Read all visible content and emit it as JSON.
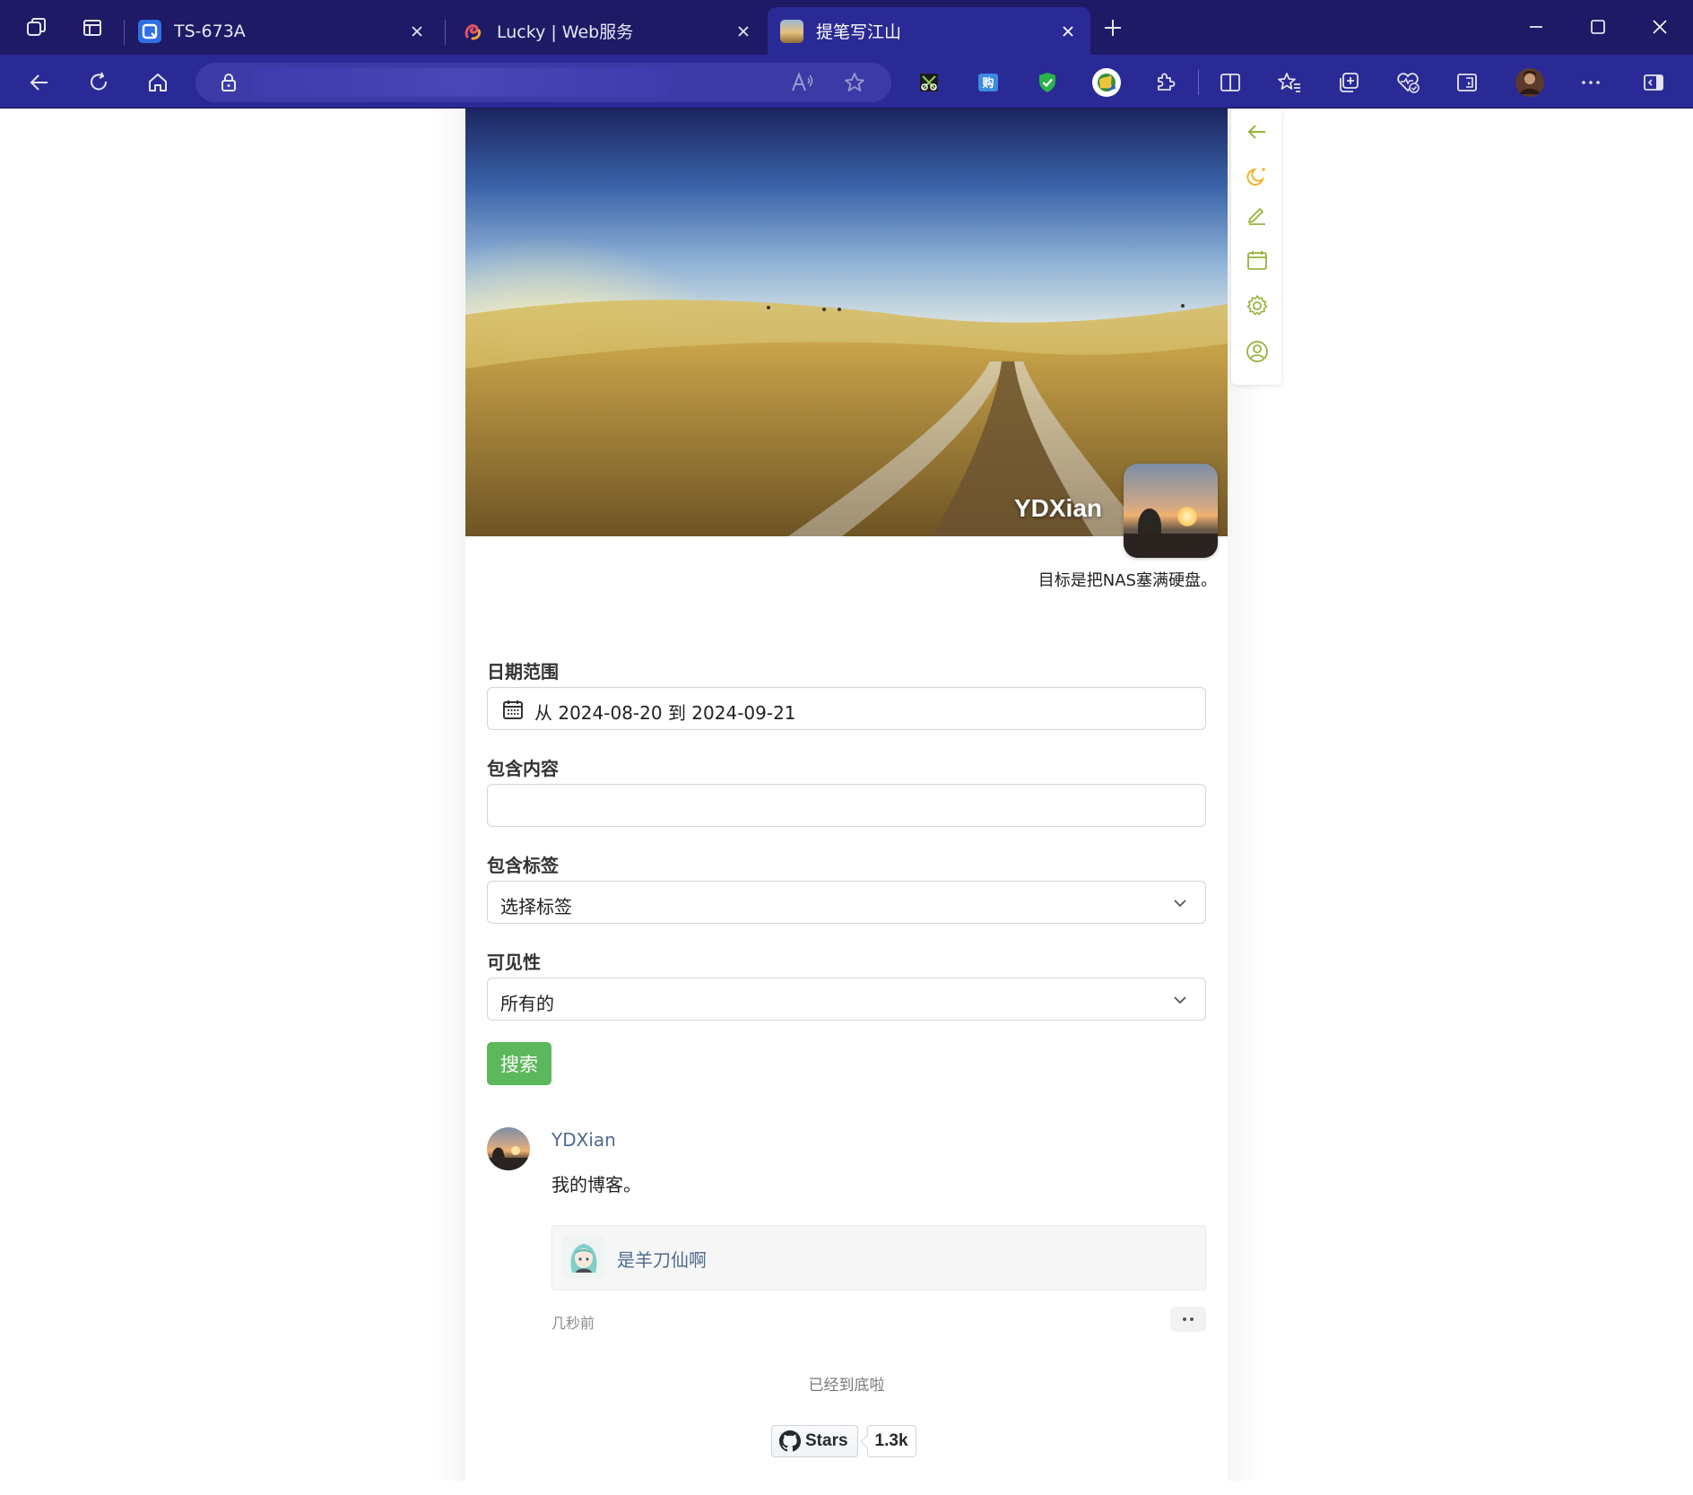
{
  "browser": {
    "tabs": [
      {
        "label": "TS-673A",
        "active": false,
        "favicon": "qnap-icon"
      },
      {
        "label": "Lucky | Web服务",
        "active": false,
        "favicon": "lucky-icon"
      },
      {
        "label": "提笔写江山",
        "active": true,
        "favicon": "blog-favicon"
      }
    ],
    "colors": {
      "titlebar": "#1e1a66",
      "toolbar": "#2a2a96",
      "accent": "#97b33a"
    }
  },
  "blog": {
    "name": "YDXian",
    "motto": "目标是把NAS塞满硬盘。"
  },
  "filters": {
    "date_range": {
      "label": "日期范围",
      "value": "从 2024-08-20 到 2024-09-21"
    },
    "content": {
      "label": "包含内容",
      "value": ""
    },
    "tags": {
      "label": "包含标签",
      "value": "选择标签"
    },
    "visibility": {
      "label": "可见性",
      "value": "所有的"
    },
    "search_label": "搜索"
  },
  "post": {
    "author": "YDXian",
    "content": "我的博客。",
    "liked_by": "是羊刀仙啊",
    "time": "几秒前"
  },
  "footer": {
    "end_text": "已经到底啦",
    "github_label": "Stars",
    "github_count": "1.3k"
  }
}
